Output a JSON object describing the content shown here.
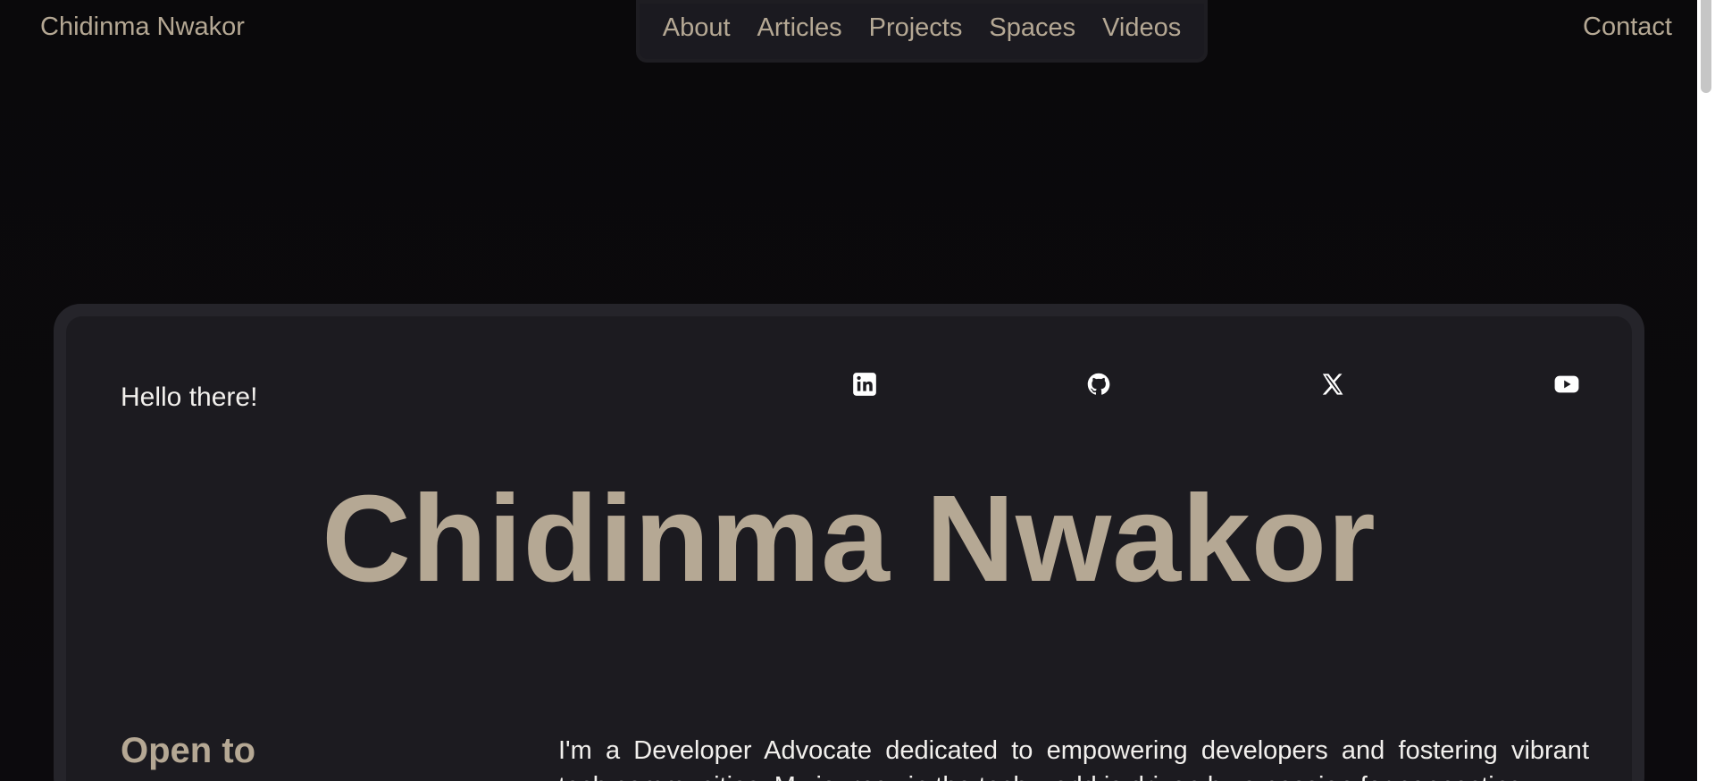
{
  "header": {
    "brand": "Chidinma Nwakor",
    "nav": [
      {
        "label": "About"
      },
      {
        "label": "Articles"
      },
      {
        "label": "Projects"
      },
      {
        "label": "Spaces"
      },
      {
        "label": "Videos"
      }
    ],
    "contact": "Contact"
  },
  "hero": {
    "greeting": "Hello there!",
    "name": "Chidinma Nwakor",
    "social": [
      {
        "icon": "linkedin-icon"
      },
      {
        "icon": "github-icon"
      },
      {
        "icon": "x-twitter-icon"
      },
      {
        "icon": "youtube-icon"
      }
    ],
    "open_to_heading": "Open to",
    "bio_line1": "I'm a Developer Advocate dedicated to empowering developers and fostering vibrant",
    "bio_line2": "tech communities. My journey in the tech world is driven by a passion for connecting"
  },
  "colors": {
    "accent": "#b5a894",
    "background": "#0b0a0c",
    "card": "#1c1b20",
    "text": "#f2f0ed"
  }
}
